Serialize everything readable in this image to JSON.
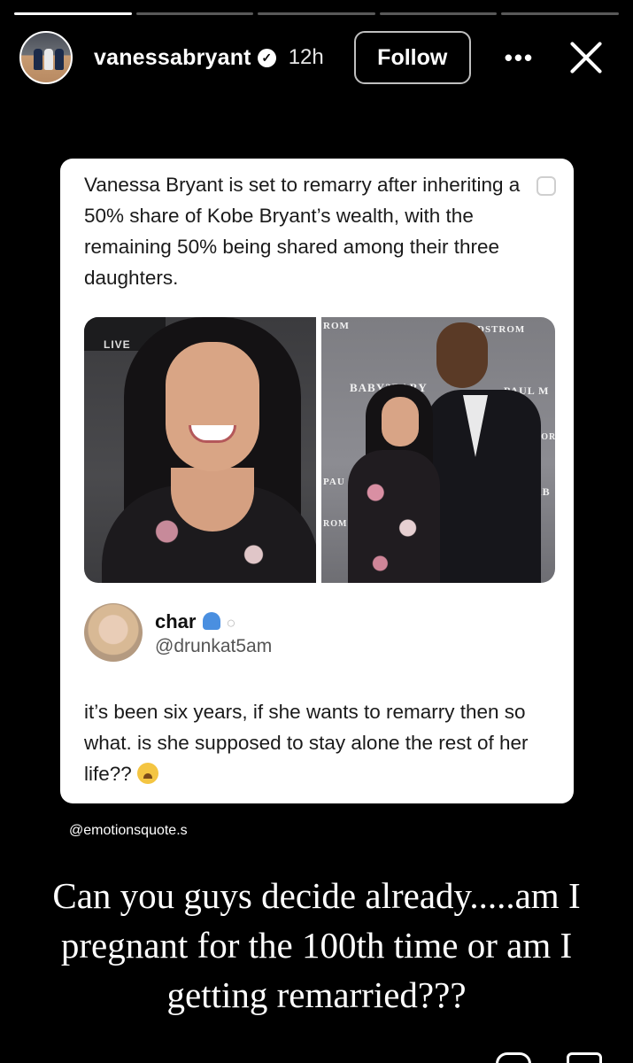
{
  "story": {
    "progress": [
      1.0,
      0.0,
      0.0,
      0.0,
      0.0
    ]
  },
  "header": {
    "username": "vanessabryant",
    "verified_glyph": "✓",
    "time": "12h",
    "follow_label": "Follow",
    "more_label": "•••",
    "avatar_icon": "profile-avatar",
    "close_icon": "close-icon"
  },
  "post": {
    "text": "Vanessa Bryant is set to remarry after inheriting a 50% share of Kobe Bryant’s wealth, with the remaining 50% being shared among their three daughters.",
    "photo_left_banner": "LIVE",
    "photo_right_sponsors": [
      "ROM",
      "DSTROM",
      "BABY2BABY",
      "PAUL M",
      "NOR",
      "PAU",
      "AB",
      "ROM"
    ]
  },
  "reply": {
    "name": "char",
    "name_emoji": "jellyfish",
    "handle": "@drunkat5am",
    "text": "it’s been six years, if she wants to remarry then so what. is she supposed to stay alone the rest of her life??",
    "trailing_emoji": "crying-face"
  },
  "watermark": "@emotionsquote.s",
  "caption": "Can you guys decide already.....am I pregnant for the 100th time or am I getting remarried???"
}
